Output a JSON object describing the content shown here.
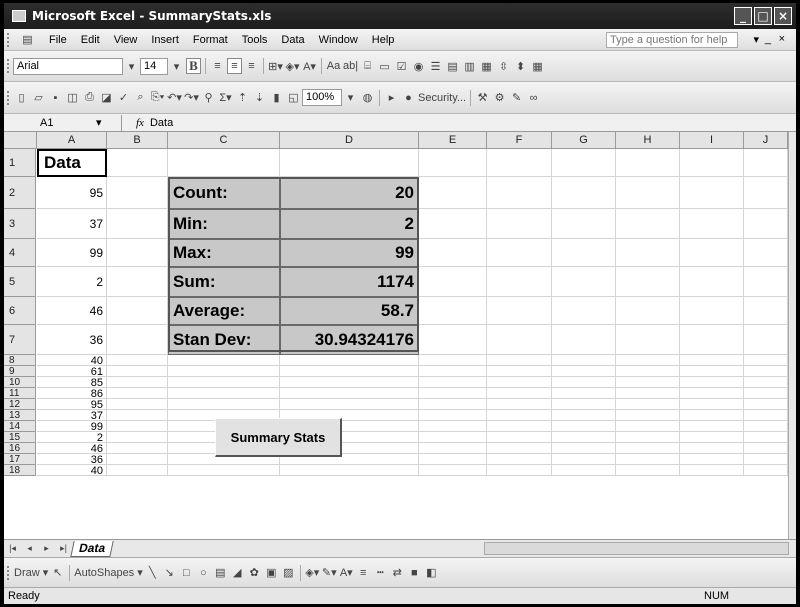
{
  "window": {
    "title": "Microsoft Excel - SummaryStats.xls",
    "controls": [
      "_",
      "□",
      "×"
    ]
  },
  "menu": {
    "items": [
      "File",
      "Edit",
      "View",
      "Insert",
      "Format",
      "Tools",
      "Data",
      "Window",
      "Help"
    ],
    "ask_placeholder": "Type a question for help",
    "doc_controls": [
      "▾",
      "_",
      "ﾠ",
      "×"
    ]
  },
  "format_toolbar": {
    "font": "Arial",
    "size": "14",
    "bold": "B"
  },
  "standard_toolbar": {
    "zoom": "100%",
    "security": "Security..."
  },
  "formula_bar": {
    "cell_ref": "A1",
    "fx": "fx",
    "content": "Data"
  },
  "columns": [
    "A",
    "B",
    "C",
    "D",
    "E",
    "F",
    "G",
    "H",
    "I",
    "J"
  ],
  "rows": [
    "1",
    "2",
    "3",
    "4",
    "5",
    "6",
    "7",
    "8",
    "9",
    "10",
    "11",
    "12",
    "13",
    "14",
    "15",
    "16",
    "17",
    "18"
  ],
  "data_header": "Data",
  "data_values": [
    "95",
    "37",
    "99",
    "2",
    "46",
    "36",
    "40",
    "61",
    "85",
    "86",
    "95",
    "37",
    "99",
    "2",
    "46",
    "36",
    "40"
  ],
  "summary": [
    {
      "label": "Count:",
      "value": "20"
    },
    {
      "label": "Min:",
      "value": "2"
    },
    {
      "label": "Max:",
      "value": "99"
    },
    {
      "label": "Sum:",
      "value": "1174"
    },
    {
      "label": "Average:",
      "value": "58.7"
    },
    {
      "label": "Stan Dev:",
      "value": "30.94324176"
    }
  ],
  "macro_button": "Summary Stats",
  "sheet_tabs": [
    "Data"
  ],
  "draw_toolbar": {
    "draw": "Draw ▾",
    "autoshapes": "AutoShapes ▾"
  },
  "status": {
    "left": "Ready",
    "num": "NUM"
  }
}
